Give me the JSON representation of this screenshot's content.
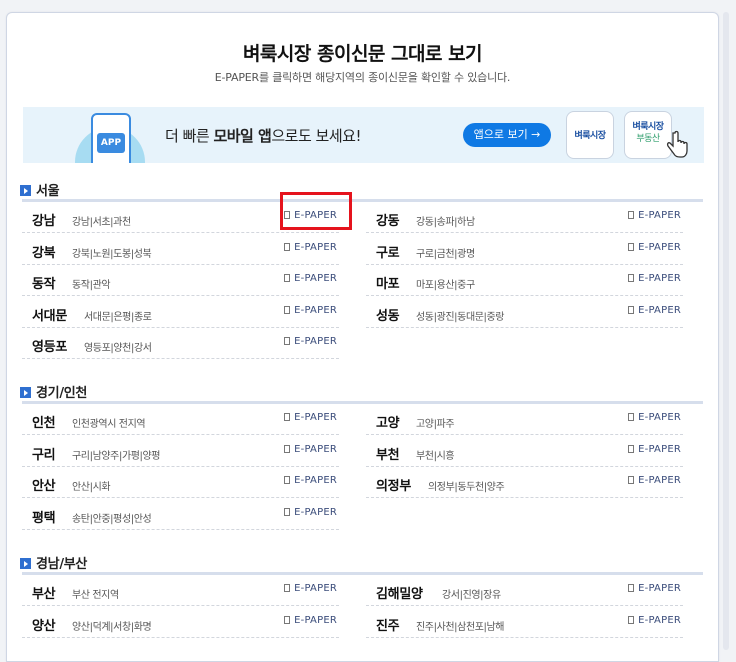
{
  "header": {
    "title": "벼룩시장 종이신문 그대로 보기",
    "subtitle": "E-PAPER를 클릭하면 해당지역의 종이신문을 확인할 수 있습니다."
  },
  "banner": {
    "phone_label": "APP",
    "text_prefix": "더 빠른 ",
    "text_bold": "모바일 앱",
    "text_suffix": "으로도 보세요!",
    "button_label": "앱으로 보기 →",
    "logo1": "벼룩시장",
    "logo2_top": "벼룩시장",
    "logo2_bottom": "부동산"
  },
  "epaper_label": "E-PAPER",
  "sections": [
    {
      "title": "서울",
      "rows": [
        {
          "name": "강남",
          "areas": "강남|서초|과천"
        },
        {
          "name": "강동",
          "areas": "강동|송파|하남"
        },
        {
          "name": "강북",
          "areas": "강북|노원|도봉|성북"
        },
        {
          "name": "구로",
          "areas": "구로|금천|광명"
        },
        {
          "name": "동작",
          "areas": "동작|관악"
        },
        {
          "name": "마포",
          "areas": "마포|용산|중구"
        },
        {
          "name": "서대문",
          "areas": "서대문|은평|종로"
        },
        {
          "name": "성동",
          "areas": "성동|광진|동대문|중랑"
        },
        {
          "name": "영등포",
          "areas": "영등포|양천|강서"
        }
      ]
    },
    {
      "title": "경기/인천",
      "rows": [
        {
          "name": "인천",
          "areas": "인천광역시 전지역"
        },
        {
          "name": "고양",
          "areas": "고양|파주"
        },
        {
          "name": "구리",
          "areas": "구리|남양주|가평|양평"
        },
        {
          "name": "부천",
          "areas": "부천|시흥"
        },
        {
          "name": "안산",
          "areas": "안산|시화"
        },
        {
          "name": "의정부",
          "areas": "의정부|동두천|양주"
        },
        {
          "name": "평택",
          "areas": "송탄|안중|평성|안성"
        }
      ]
    },
    {
      "title": "경남/부산",
      "rows": [
        {
          "name": "부산",
          "areas": "부산 전지역"
        },
        {
          "name": "김해밀양",
          "areas": "강서|진영|장유"
        },
        {
          "name": "양산",
          "areas": "양산|덕계|서창|화명"
        },
        {
          "name": "진주",
          "areas": "진주|사천|삼천포|남해"
        }
      ]
    }
  ],
  "colors": {
    "accent": "#0f79e4",
    "section_icon": "#2f6fd0",
    "highlight": "#e5131d",
    "banner_bg": "#e7f3fb"
  }
}
